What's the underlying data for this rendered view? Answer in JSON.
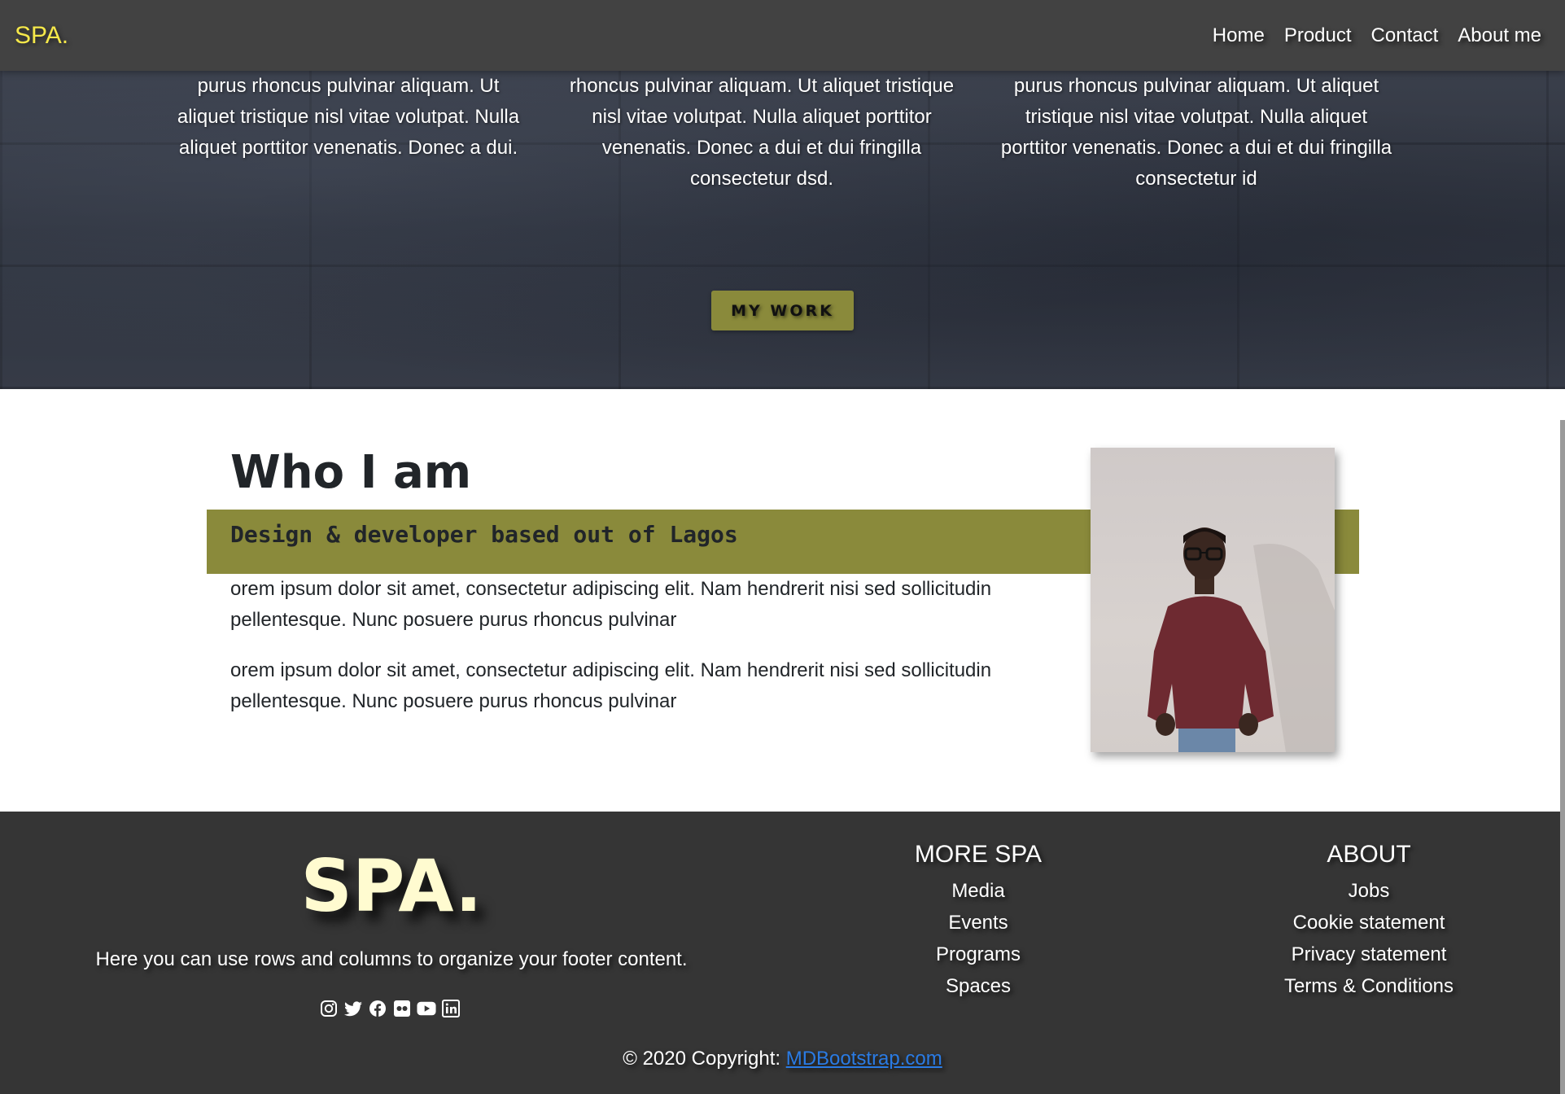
{
  "navbar": {
    "brand": "SPA.",
    "links": [
      "Home",
      "Product",
      "Contact",
      "About me"
    ],
    "brand_color": "#f5e84a",
    "bg_color": "#424242"
  },
  "hero": {
    "columns": [
      "purus rhoncus pulvinar aliquam. Ut aliquet tristique nisl vitae volutpat. Nulla aliquet porttitor venenatis. Donec a dui.",
      "rhoncus pulvinar aliquam. Ut aliquet tristique nisl vitae volutpat. Nulla aliquet porttitor venenatis. Donec a dui et dui fringilla consectetur dsd.",
      "purus rhoncus pulvinar aliquam. Ut aliquet tristique nisl vitae volutpat. Nulla aliquet porttitor venenatis. Donec a dui et dui fringilla consectetur id"
    ],
    "button_label": "MY WORK",
    "accent_color": "#8a8a3b"
  },
  "about": {
    "title": "Who I am",
    "subtitle": "Design & developer based out of Lagos",
    "paragraphs": [
      "orem ipsum dolor sit amet, consectetur adipiscing elit. Nam hendrerit nisi sed sollicitudin pellentesque. Nunc posuere purus rhoncus pulvinar",
      "orem ipsum dolor sit amet, consectetur adipiscing elit. Nam hendrerit nisi sed sollicitudin pellentesque. Nunc posuere purus rhoncus pulvinar"
    ]
  },
  "footer": {
    "logo": "SPA.",
    "description": "Here you can use rows and columns to organize your footer content.",
    "social_icons": [
      "instagram-icon",
      "twitter-icon",
      "facebook-icon",
      "flickr-icon",
      "youtube-icon",
      "linkedin-icon"
    ],
    "more": {
      "heading": "MORE SPA",
      "links": [
        "Media",
        "Events",
        "Programs",
        "Spaces"
      ]
    },
    "about": {
      "heading": "ABOUT",
      "links": [
        "Jobs",
        "Cookie statement",
        "Privacy statement",
        "Terms & Conditions"
      ]
    },
    "copyright_prefix": "© 2020 Copyright:",
    "copyright_link": "MDBootstrap.com",
    "link_color": "#2a7be4"
  }
}
